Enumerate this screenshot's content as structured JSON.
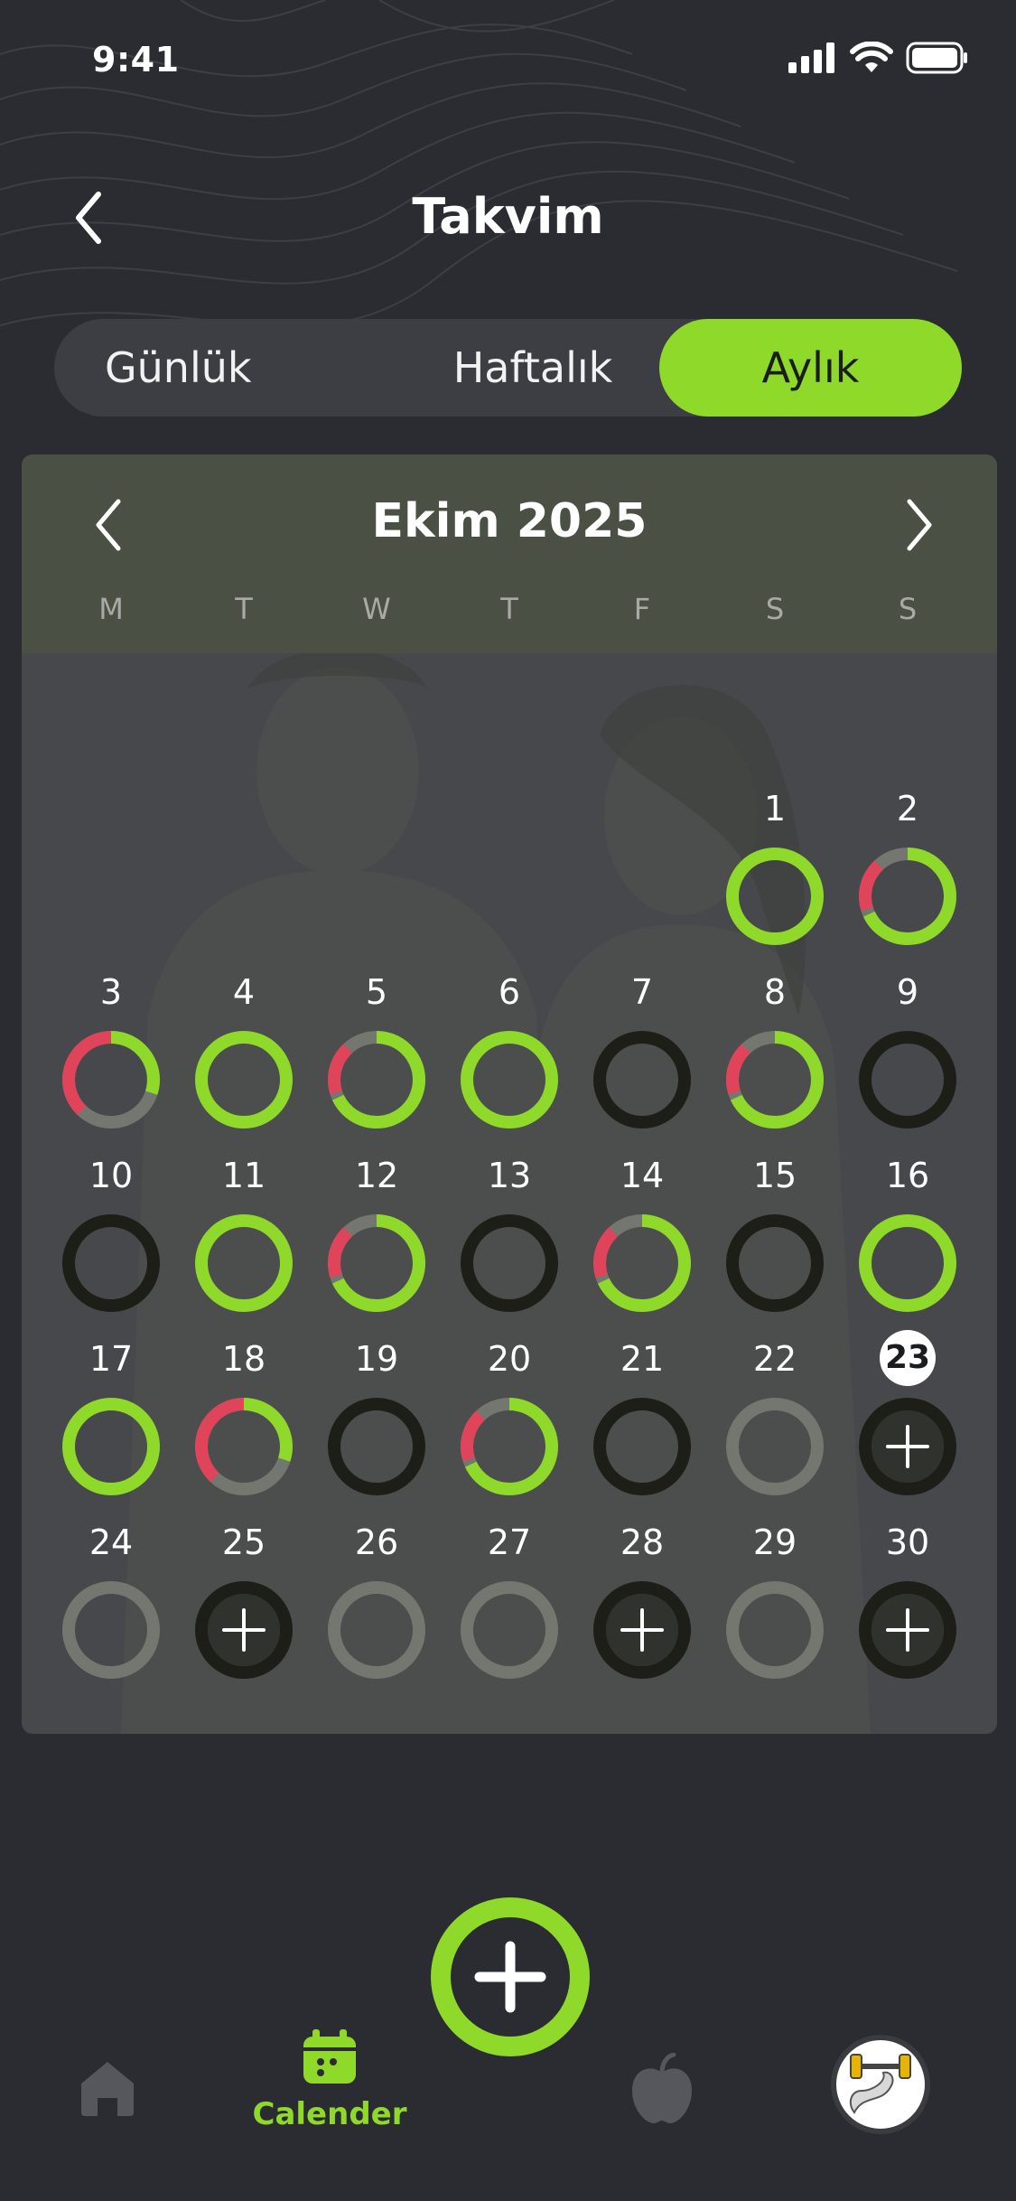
{
  "status_bar": {
    "time": "9:41"
  },
  "header": {
    "title": "Takvim"
  },
  "tabs": {
    "daily": "Günlük",
    "weekly": "Haftalık",
    "monthly": "Aylık"
  },
  "calendar": {
    "month_label": "Ekim 2025",
    "weekdays": [
      "M",
      "T",
      "W",
      "T",
      "F",
      "S",
      "S"
    ],
    "today": "23",
    "days": [
      {
        "num": "1",
        "status": "complete"
      },
      {
        "num": "2",
        "status": "partial-red"
      },
      {
        "num": "3",
        "status": "mostly-red"
      },
      {
        "num": "4",
        "status": "complete"
      },
      {
        "num": "5",
        "status": "partial-red"
      },
      {
        "num": "6",
        "status": "complete"
      },
      {
        "num": "7",
        "status": "missed"
      },
      {
        "num": "8",
        "status": "partial-red"
      },
      {
        "num": "9",
        "status": "missed"
      },
      {
        "num": "10",
        "status": "missed"
      },
      {
        "num": "11",
        "status": "complete"
      },
      {
        "num": "12",
        "status": "partial-red"
      },
      {
        "num": "13",
        "status": "missed"
      },
      {
        "num": "14",
        "status": "partial-red"
      },
      {
        "num": "15",
        "status": "missed"
      },
      {
        "num": "16",
        "status": "complete"
      },
      {
        "num": "17",
        "status": "complete"
      },
      {
        "num": "18",
        "status": "mostly-red"
      },
      {
        "num": "19",
        "status": "missed"
      },
      {
        "num": "20",
        "status": "partial-red"
      },
      {
        "num": "21",
        "status": "missed"
      },
      {
        "num": "22",
        "status": "rest"
      },
      {
        "num": "23",
        "status": "add"
      },
      {
        "num": "24",
        "status": "rest"
      },
      {
        "num": "25",
        "status": "add"
      },
      {
        "num": "26",
        "status": "rest"
      },
      {
        "num": "27",
        "status": "rest"
      },
      {
        "num": "28",
        "status": "add"
      },
      {
        "num": "29",
        "status": "rest"
      },
      {
        "num": "30",
        "status": "add"
      }
    ],
    "colors": {
      "green": "#8fd92a",
      "red": "#e0445a",
      "gray": "#74776f",
      "dark": "#1c1e17"
    }
  },
  "nav": {
    "home_icon": "home-icon",
    "calendar_label": "Calender",
    "nutrition_icon": "apple-icon",
    "profile_icon": "dumbbell-avatar"
  }
}
